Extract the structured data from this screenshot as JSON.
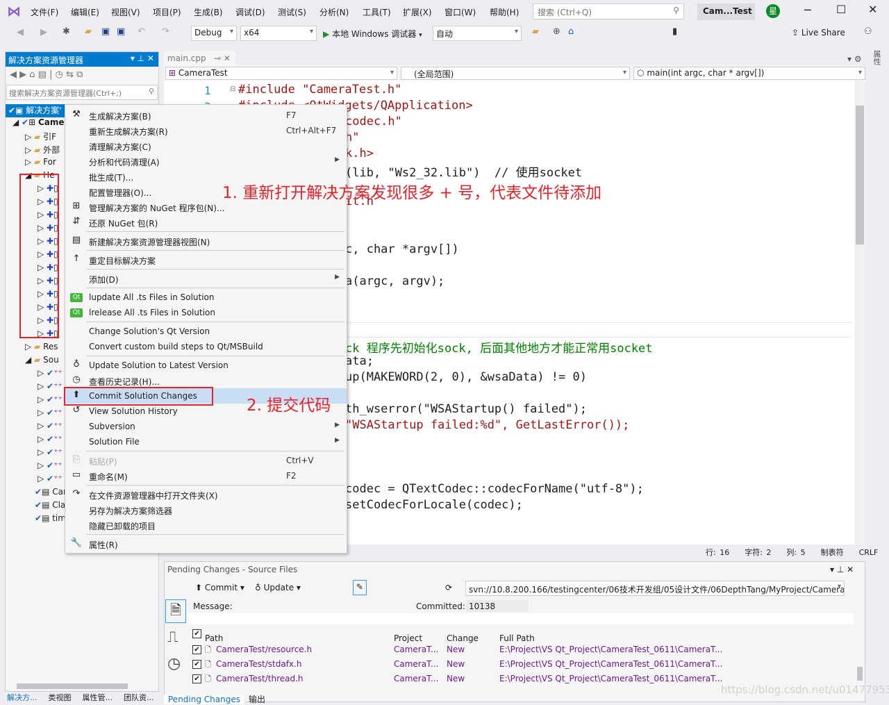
{
  "title_bar": {
    "menus": [
      "文件(F)",
      "编辑(E)",
      "视图(V)",
      "项目(P)",
      "生成(B)",
      "调试(D)",
      "测试(S)",
      "分析(N)",
      "工具(T)",
      "扩展(X)",
      "窗口(W)",
      "帮助(H)"
    ],
    "search_placeholder": "搜索 (Ctrl+Q)",
    "solution_name": "Cam...Test",
    "avatar": "星"
  },
  "toolbar": {
    "config": "Debug",
    "platform": "x64",
    "run_label": "本地 Windows 调试器",
    "run_mode": "自动",
    "live_share": "Live Share"
  },
  "solution_explorer": {
    "title": "解决方案资源管理器",
    "search_placeholder": "搜索解决方案资源管理器(Ctrl+;)",
    "rows": [
      {
        "t": "解决方案'",
        "sel": true
      },
      {
        "t": "Came",
        "bold": true
      },
      {
        "t": "引F"
      },
      {
        "t": "外部"
      },
      {
        "t": "For"
      },
      {
        "t": "He"
      },
      {
        "t": ""
      },
      {
        "t": ""
      },
      {
        "t": ""
      },
      {
        "t": ""
      },
      {
        "t": ""
      },
      {
        "t": ""
      },
      {
        "t": ""
      },
      {
        "t": ""
      },
      {
        "t": ""
      },
      {
        "t": ""
      },
      {
        "t": ""
      },
      {
        "t": ""
      },
      {
        "t": "Res"
      },
      {
        "t": "Sou"
      },
      {
        "t": ""
      },
      {
        "t": ""
      },
      {
        "t": ""
      },
      {
        "t": ""
      },
      {
        "t": ""
      },
      {
        "t": ""
      },
      {
        "t": ""
      },
      {
        "t": ""
      },
      {
        "t": ""
      },
      {
        "t": "Car"
      },
      {
        "t": "Cla"
      },
      {
        "t": "tim"
      }
    ],
    "bottom_tabs": [
      "解决方...",
      "类视图",
      "属性管...",
      "团队资..."
    ]
  },
  "editor": {
    "tab": "main.cpp",
    "nav_project": "CameraTest",
    "nav_scope": "(全局范围)",
    "nav_function": "main(int argc, char * argv[])",
    "line_numbers": [
      "1",
      "2"
    ],
    "code": [
      {
        "t": "#include \"CameraTest.h\"",
        "c": "#a31515",
        "full": true
      },
      {
        "t": "#include <QtWidgets/QApplication>",
        "c": "#a31515",
        "full": true
      },
      {
        "t": "codec.h\"",
        "c": "#a31515"
      },
      {
        "t": "h\"",
        "c": "#a31515"
      },
      {
        "t": "k.h>",
        "c": "#a31515"
      },
      {
        "t": "(lib, \"Ws2_32.lib\")  // 使用socket",
        "c": "#1e1e1e"
      },
      {
        "t": ""
      },
      {
        "t": "it.h",
        "c": "#a31515"
      },
      {
        "t": ""
      },
      {
        "t": ""
      },
      {
        "t": "c, char *argv[])",
        "c": "#1e1e1e"
      },
      {
        "t": ""
      },
      {
        "t": "a(argc, argv);",
        "c": "#1e1e1e"
      },
      {
        "t": ""
      },
      {
        "t": ""
      },
      {
        "t": ""
      },
      {
        "t": "ck 程序先初始化sock, 后面其他地方才能正常用socket",
        "c": "#008000"
      },
      {
        "t": "ata;",
        "c": "#1e1e1e"
      },
      {
        "t": "up(MAKEWORD(2, 0), &wsaData) != 0)",
        "c": "#1e1e1e"
      },
      {
        "t": ""
      },
      {
        "t": "th_wserror(\"WSAStartup() failed\");",
        "c": "#1e1e1e"
      },
      {
        "t": "\"WSAStartup failed:%d\", GetLastError());",
        "c": "#a31515"
      },
      {
        "t": ""
      },
      {
        "t": ""
      },
      {
        "t": ""
      },
      {
        "t": "codec = QTextCodec::codecForName(\"utf-8\");",
        "c": "#1e1e1e"
      },
      {
        "t": "setCodecForLocale(codec);",
        "c": "#1e1e1e"
      }
    ],
    "status": {
      "line": "行: 16",
      "char": "字符: 2",
      "col": "列: 5",
      "tabs": "制表符",
      "eol": "CRLF"
    }
  },
  "context_menu": {
    "items": [
      {
        "ic": "⚒",
        "l": "生成解决方案(B)",
        "sc": "F7"
      },
      {
        "l": "重新生成解决方案(R)",
        "sc": "Ctrl+Alt+F7"
      },
      {
        "l": "清理解决方案(C)"
      },
      {
        "l": "分析和代码清理(A)",
        "sub": true
      },
      {
        "l": "批生成(T)..."
      },
      {
        "l": "配置管理器(O)..."
      },
      {
        "ic": "⊞",
        "l": "管理解决方案的 NuGet 程序包(N)..."
      },
      {
        "ic": "⇵",
        "l": "还原 NuGet 包(R)",
        "sep": true
      },
      {
        "ic": "▤",
        "l": "新建解决方案资源管理器视图(N)",
        "sep": true
      },
      {
        "ic": "↑",
        "l": "重定目标解决方案",
        "sep": true
      },
      {
        "l": "添加(D)",
        "sub": true,
        "sep": true
      },
      {
        "ic": "Qt",
        "l": "lupdate All .ts Files in Solution"
      },
      {
        "ic": "Qt",
        "l": "lrelease All .ts Files in Solution",
        "sep": true
      },
      {
        "l": "Change Solution's Qt Version"
      },
      {
        "l": "Convert custom build steps to Qt/MSBuild",
        "sep": true
      },
      {
        "ic": "♁",
        "l": "Update Solution to Latest Version"
      },
      {
        "ic": "◷",
        "l": "查看历史记录(H)..."
      },
      {
        "ic": "⬆",
        "l": "Commit Solution Changes",
        "hl": true
      },
      {
        "ic": "↺",
        "l": "View Solution History"
      },
      {
        "l": "Subversion",
        "sub": true
      },
      {
        "l": "Solution File",
        "sub": true,
        "sep": true
      },
      {
        "ic": "⎘",
        "l": "粘贴(P)",
        "sc": "Ctrl+V",
        "dis": true
      },
      {
        "ic": "▭",
        "l": "重命名(M)",
        "sc": "F2",
        "sep": true
      },
      {
        "ic": "↷",
        "l": "在文件资源管理器中打开文件夹(X)"
      },
      {
        "l": "另存为解决方案筛选器"
      },
      {
        "l": "隐藏已卸载的项目",
        "sep": true
      },
      {
        "ic": "🔧",
        "l": "属性(R)"
      }
    ]
  },
  "annotations": {
    "note1": "1. 重新打开解决方案发现很多 + 号，代表文件待添加",
    "note2": "2. 提交代码"
  },
  "pending_changes": {
    "title": "Pending Changes - Source Files",
    "commit": "Commit",
    "update": "Update",
    "repo_url": "svn://10.8.200.166/testingcenter/06技术开发组/05设计文件/06DepthTang/MyProject/CameraTest",
    "message_label": "Message:",
    "committed_label": "Committed:",
    "committed_value": "10138",
    "columns": [
      "Path",
      "Project",
      "Change",
      "Full Path"
    ],
    "rows": [
      {
        "path": "CameraTest/resource.h",
        "project": "CameraT...",
        "change": "New",
        "full": "E:\\Project\\VS Qt_Project\\CameraTest_0611\\CameraT..."
      },
      {
        "path": "CameraTest/stdafx.h",
        "project": "CameraT...",
        "change": "New",
        "full": "E:\\Project\\VS Qt_Project\\CameraTest_0611\\CameraT..."
      },
      {
        "path": "CameraTest/thread.h",
        "project": "CameraT...",
        "change": "New",
        "full": "E:\\Project\\VS Qt_Project\\CameraTest_0611\\CameraT..."
      }
    ],
    "bottom_tabs": [
      "Pending Changes",
      "输出"
    ]
  },
  "watermark": "https://blog.csdn.net/u014779536",
  "colors": {
    "accent": "#007acc",
    "annotation": "#e8202a",
    "vs_logo": "#865fc5",
    "highlight": "#c9def5"
  }
}
